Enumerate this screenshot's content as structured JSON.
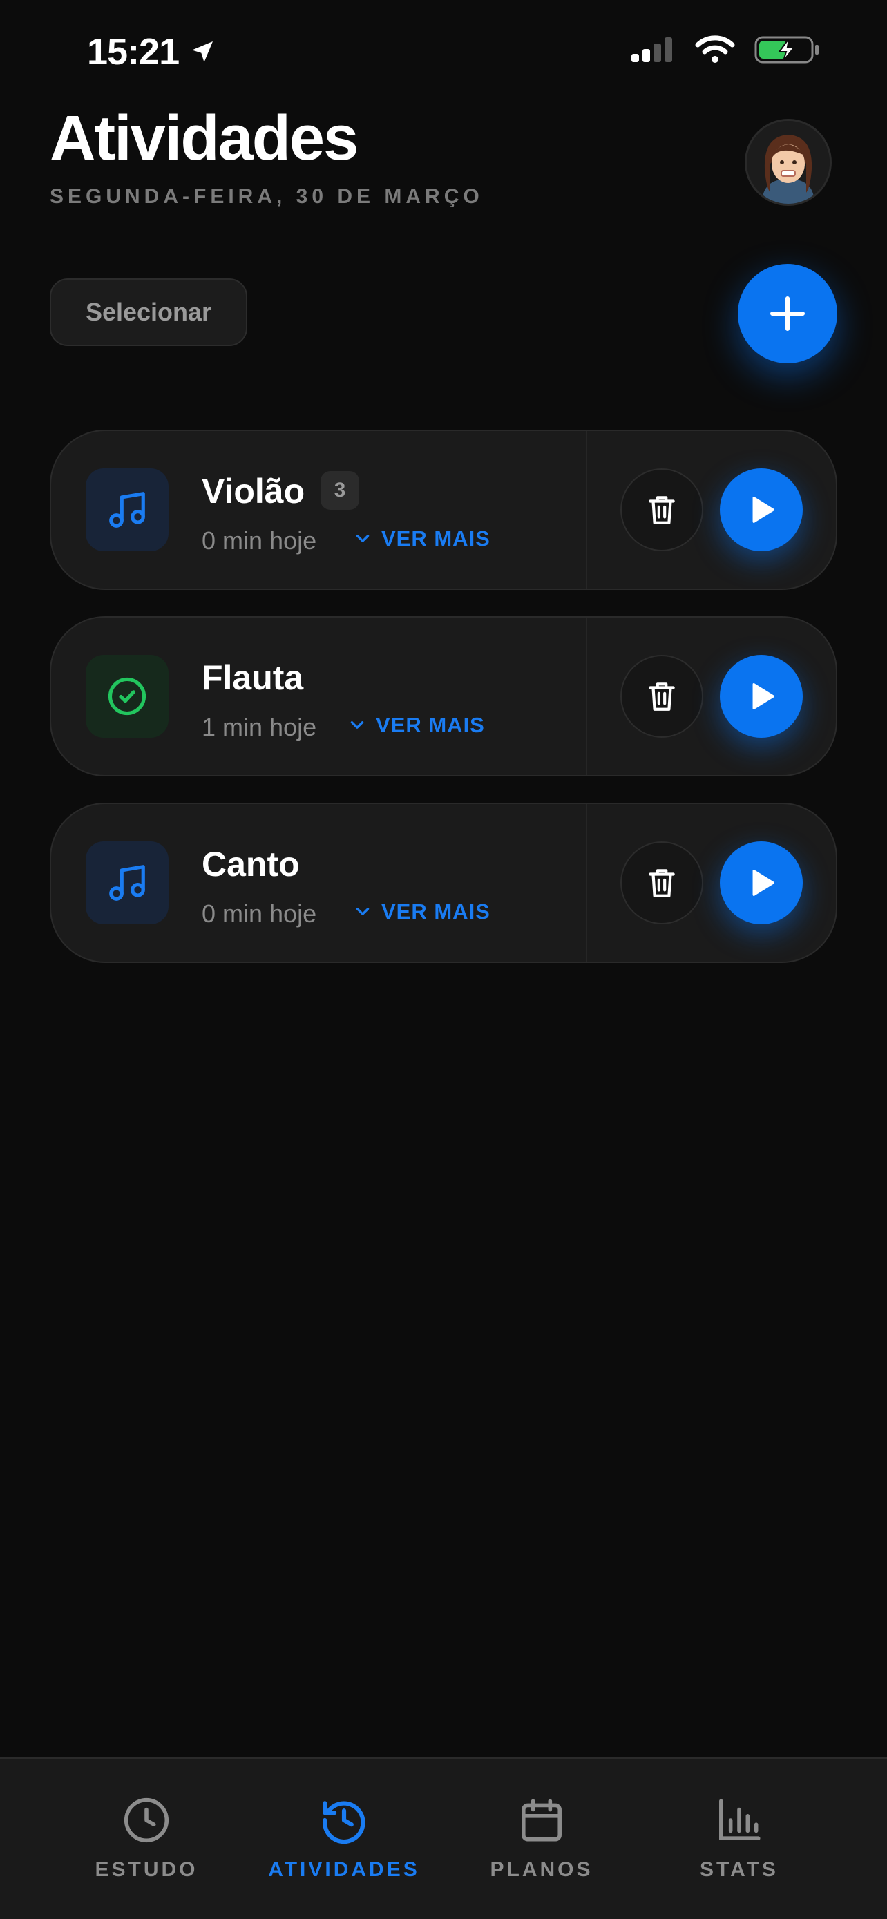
{
  "status_bar": {
    "time": "15:21"
  },
  "header": {
    "title": "Atividades",
    "date": "SEGUNDA-FEIRA, 30 DE MARÇO"
  },
  "toolbar": {
    "select_label": "Selecionar"
  },
  "activities": [
    {
      "name": "Violão",
      "badge": "3",
      "time_today": "0 min hoje",
      "more_label": "VER MAIS",
      "icon": "music-note-icon"
    },
    {
      "name": "Flauta",
      "time_today": "1 min hoje",
      "more_label": "VER MAIS",
      "icon": "check-circle-icon"
    },
    {
      "name": "Canto",
      "time_today": "0 min hoje",
      "more_label": "VER MAIS",
      "icon": "music-note-icon"
    }
  ],
  "tabbar": {
    "tabs": [
      {
        "label": "ESTUDO",
        "icon": "clock-icon",
        "active": false
      },
      {
        "label": "ATIVIDADES",
        "icon": "history-icon",
        "active": true
      },
      {
        "label": "PLANOS",
        "icon": "calendar-icon",
        "active": false
      },
      {
        "label": "STATS",
        "icon": "bar-chart-icon",
        "active": false
      }
    ]
  },
  "colors": {
    "background": "#0c0c0c",
    "accent": "#0a74f0",
    "card": "#1b1b1b",
    "success": "#22c55e",
    "muted": "#8a8a8a"
  }
}
